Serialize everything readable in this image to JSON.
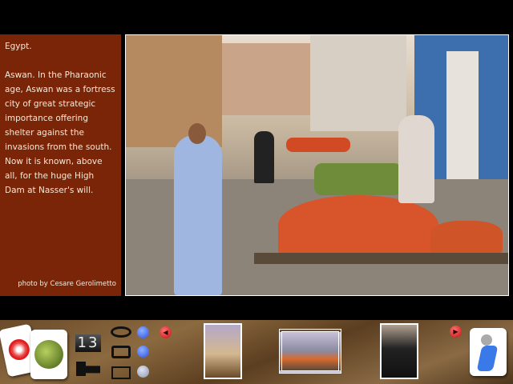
{
  "caption": {
    "title": "Egypt.",
    "body": "Aswan. In the Pharaonic age, Aswan was a fortress city of great strategic importance offering shelter against the invasions from the south. Now it is known, above all, for the huge High Dam at  Nasser's will.",
    "credit": "photo by Cesare Gerolimetto"
  },
  "toolbar": {
    "counter": "13",
    "icons": [
      "compass-card",
      "globe-card",
      "eye",
      "camera",
      "postcard",
      "film",
      "prev-arrow",
      "next-arrow",
      "walking-person"
    ],
    "thumbnails": [
      "mosque",
      "market",
      "veiled-woman"
    ]
  },
  "colors": {
    "panel": "#7a2408",
    "dot_active": "#2a4fe0",
    "dot_inactive": "#9aa4c0",
    "arrow": "#d8181a"
  }
}
